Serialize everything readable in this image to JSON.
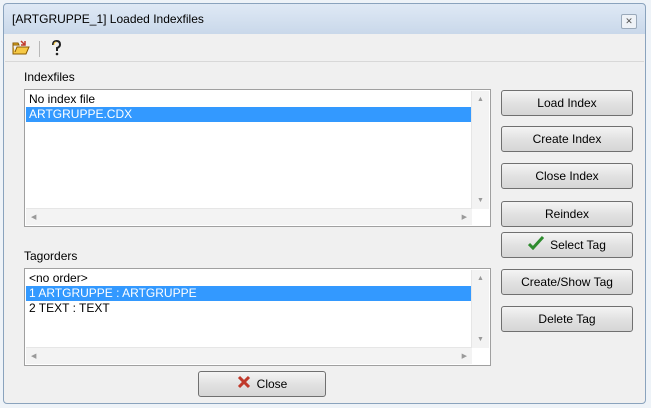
{
  "window": {
    "title": "[ARTGRUPPE_1] Loaded Indexfiles"
  },
  "toolbar": {
    "icons": [
      "open-folder-icon",
      "help-icon"
    ]
  },
  "indexfiles": {
    "label": "Indexfiles",
    "items": [
      "No index file",
      "ARTGRUPPE.CDX"
    ],
    "selected_index": 1
  },
  "tagorders": {
    "label": "Tagorders",
    "items": [
      "<no order>",
      "1 ARTGRUPPE : ARTGRUPPE",
      "2 TEXT : TEXT"
    ],
    "selected_index": 1
  },
  "buttons": {
    "load_index": "Load Index",
    "create_index": "Create Index",
    "close_index": "Close Index",
    "reindex": "Reindex",
    "select_tag": "Select Tag",
    "create_show_tag": "Create/Show Tag",
    "delete_tag": "Delete Tag",
    "close": "Close"
  },
  "colors": {
    "selection": "#3399ff",
    "check": "#2e8b2e",
    "close_x": "#c0392b"
  }
}
